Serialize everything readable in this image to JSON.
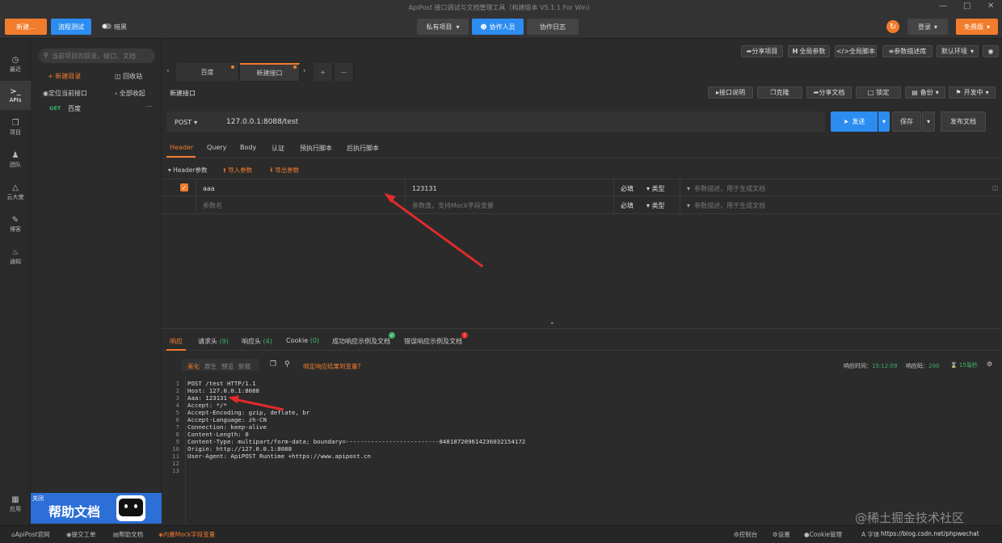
{
  "window": {
    "title": "ApiPost 接口调试与文档管理工具（构建版本 V5.1.1 For Win）"
  },
  "topbar": {
    "new_button": "新建...",
    "flow_test_button": "流程测试",
    "dark_label": "暗黑",
    "project_select": "私有项目",
    "collab_button": "协作人员",
    "collab_log_button": "协作日志",
    "login_button": "登录",
    "free_button": "免费版"
  },
  "leftnav": [
    {
      "icon": "clock-icon",
      "label": "最近"
    },
    {
      "icon": "api-icon",
      "label": "APIs"
    },
    {
      "icon": "project-icon",
      "label": "项目"
    },
    {
      "icon": "team-icon",
      "label": "团队"
    },
    {
      "icon": "cloud-icon",
      "label": "云大使"
    },
    {
      "icon": "blog-icon",
      "label": "博客"
    },
    {
      "icon": "bell-icon",
      "label": "通知"
    },
    {
      "icon": "apps-icon",
      "label": "应用"
    }
  ],
  "sidebar": {
    "search_placeholder": "当前项目的目录、接口、文档",
    "new_folder": "新建目录",
    "recycle": "回收站",
    "locate": "定位当前接口",
    "collapse_all": "全部收起",
    "items": [
      {
        "method": "GET",
        "name": "百度"
      }
    ],
    "help_banner_close": "关闭",
    "help_banner_text": "帮助文档"
  },
  "tabs": [
    {
      "label": "百度"
    },
    {
      "label": "新建接口"
    }
  ],
  "toolbar_right": {
    "share_project": "分享项目",
    "global_params": "全局参数",
    "global_script": "全局脚本",
    "param_library": "参数描述库",
    "env_select": "默认环境"
  },
  "api": {
    "name": "新建接口",
    "doc_button": "接口说明",
    "clone_button": "克隆",
    "share_doc_button": "分享文档",
    "lock_button": "锁定",
    "backup_button": "备份",
    "status_select": "开发中",
    "method": "POST",
    "url": "127.0.0.1:8088/test",
    "send_button": "发送",
    "save_button": "保存",
    "publish_button": "发布文档"
  },
  "request_tabs": [
    "Header",
    "Query",
    "Body",
    "认证",
    "预执行脚本",
    "后执行脚本"
  ],
  "header_params": {
    "section_label": "Header参数",
    "import_label": "导入参数",
    "export_label": "导出参数",
    "rows": [
      {
        "key": "aaa",
        "value": "123131",
        "required": "必填",
        "type": "类型",
        "desc_placeholder": "参数描述，用于生成文档"
      }
    ],
    "new_key_placeholder": "参数名",
    "new_value_placeholder": "参数值，支持Mock字段变量",
    "new_required": "必填",
    "new_type": "类型",
    "new_desc_placeholder": "参数描述，用于生成文档"
  },
  "response_tabs": [
    "响应",
    "请求头",
    "响应头",
    "Cookie",
    "成功响应示例及文档",
    "错误响应示例及文档"
  ],
  "response_tab_counts": [
    "",
    "(9)",
    "(4)",
    "(0)",
    "",
    ""
  ],
  "response_view": {
    "modes": [
      "美化",
      "原生",
      "预览",
      "新窗"
    ],
    "bind_link": "绑定响应结果到变量?",
    "time_label": "响应时间：",
    "time_value": "15:12:09",
    "code_label": "响应码：",
    "code_value": "200",
    "duration_value": "15毫秒"
  },
  "response_lines": [
    "POST /test HTTP/1.1",
    "Host: 127.0.0.1:8088",
    "Aaa: 123131",
    "Accept: */*",
    "Accept-Encoding: gzip, deflate, br",
    "Accept-Language: zh-CN",
    "Connection: keep-alive",
    "Content-Length: 0",
    "Content-Type: multipart/form-data; boundary=--------------------------848187209614236032154172",
    "Origin: http://127.0.0.1:8088",
    "User-Agent: ApiPOST Runtime +https://www.apipost.cn",
    "",
    ""
  ],
  "statusbar": {
    "site": "ApiPost官网",
    "ticket": "提交工单",
    "help": "帮助文档",
    "mock": "内置Mock字段变量",
    "console": "控制台",
    "settings": "设置",
    "cookie": "Cookie管理",
    "font": "字体",
    "watermark_url": "https://blog.csdn.net/phpwechat",
    "watermark_brand": "@稀土掘金技术社区"
  },
  "colors": {
    "accent": "#f07c2c",
    "primary": "#2c8cf0",
    "annotation": "#e12b2b"
  }
}
